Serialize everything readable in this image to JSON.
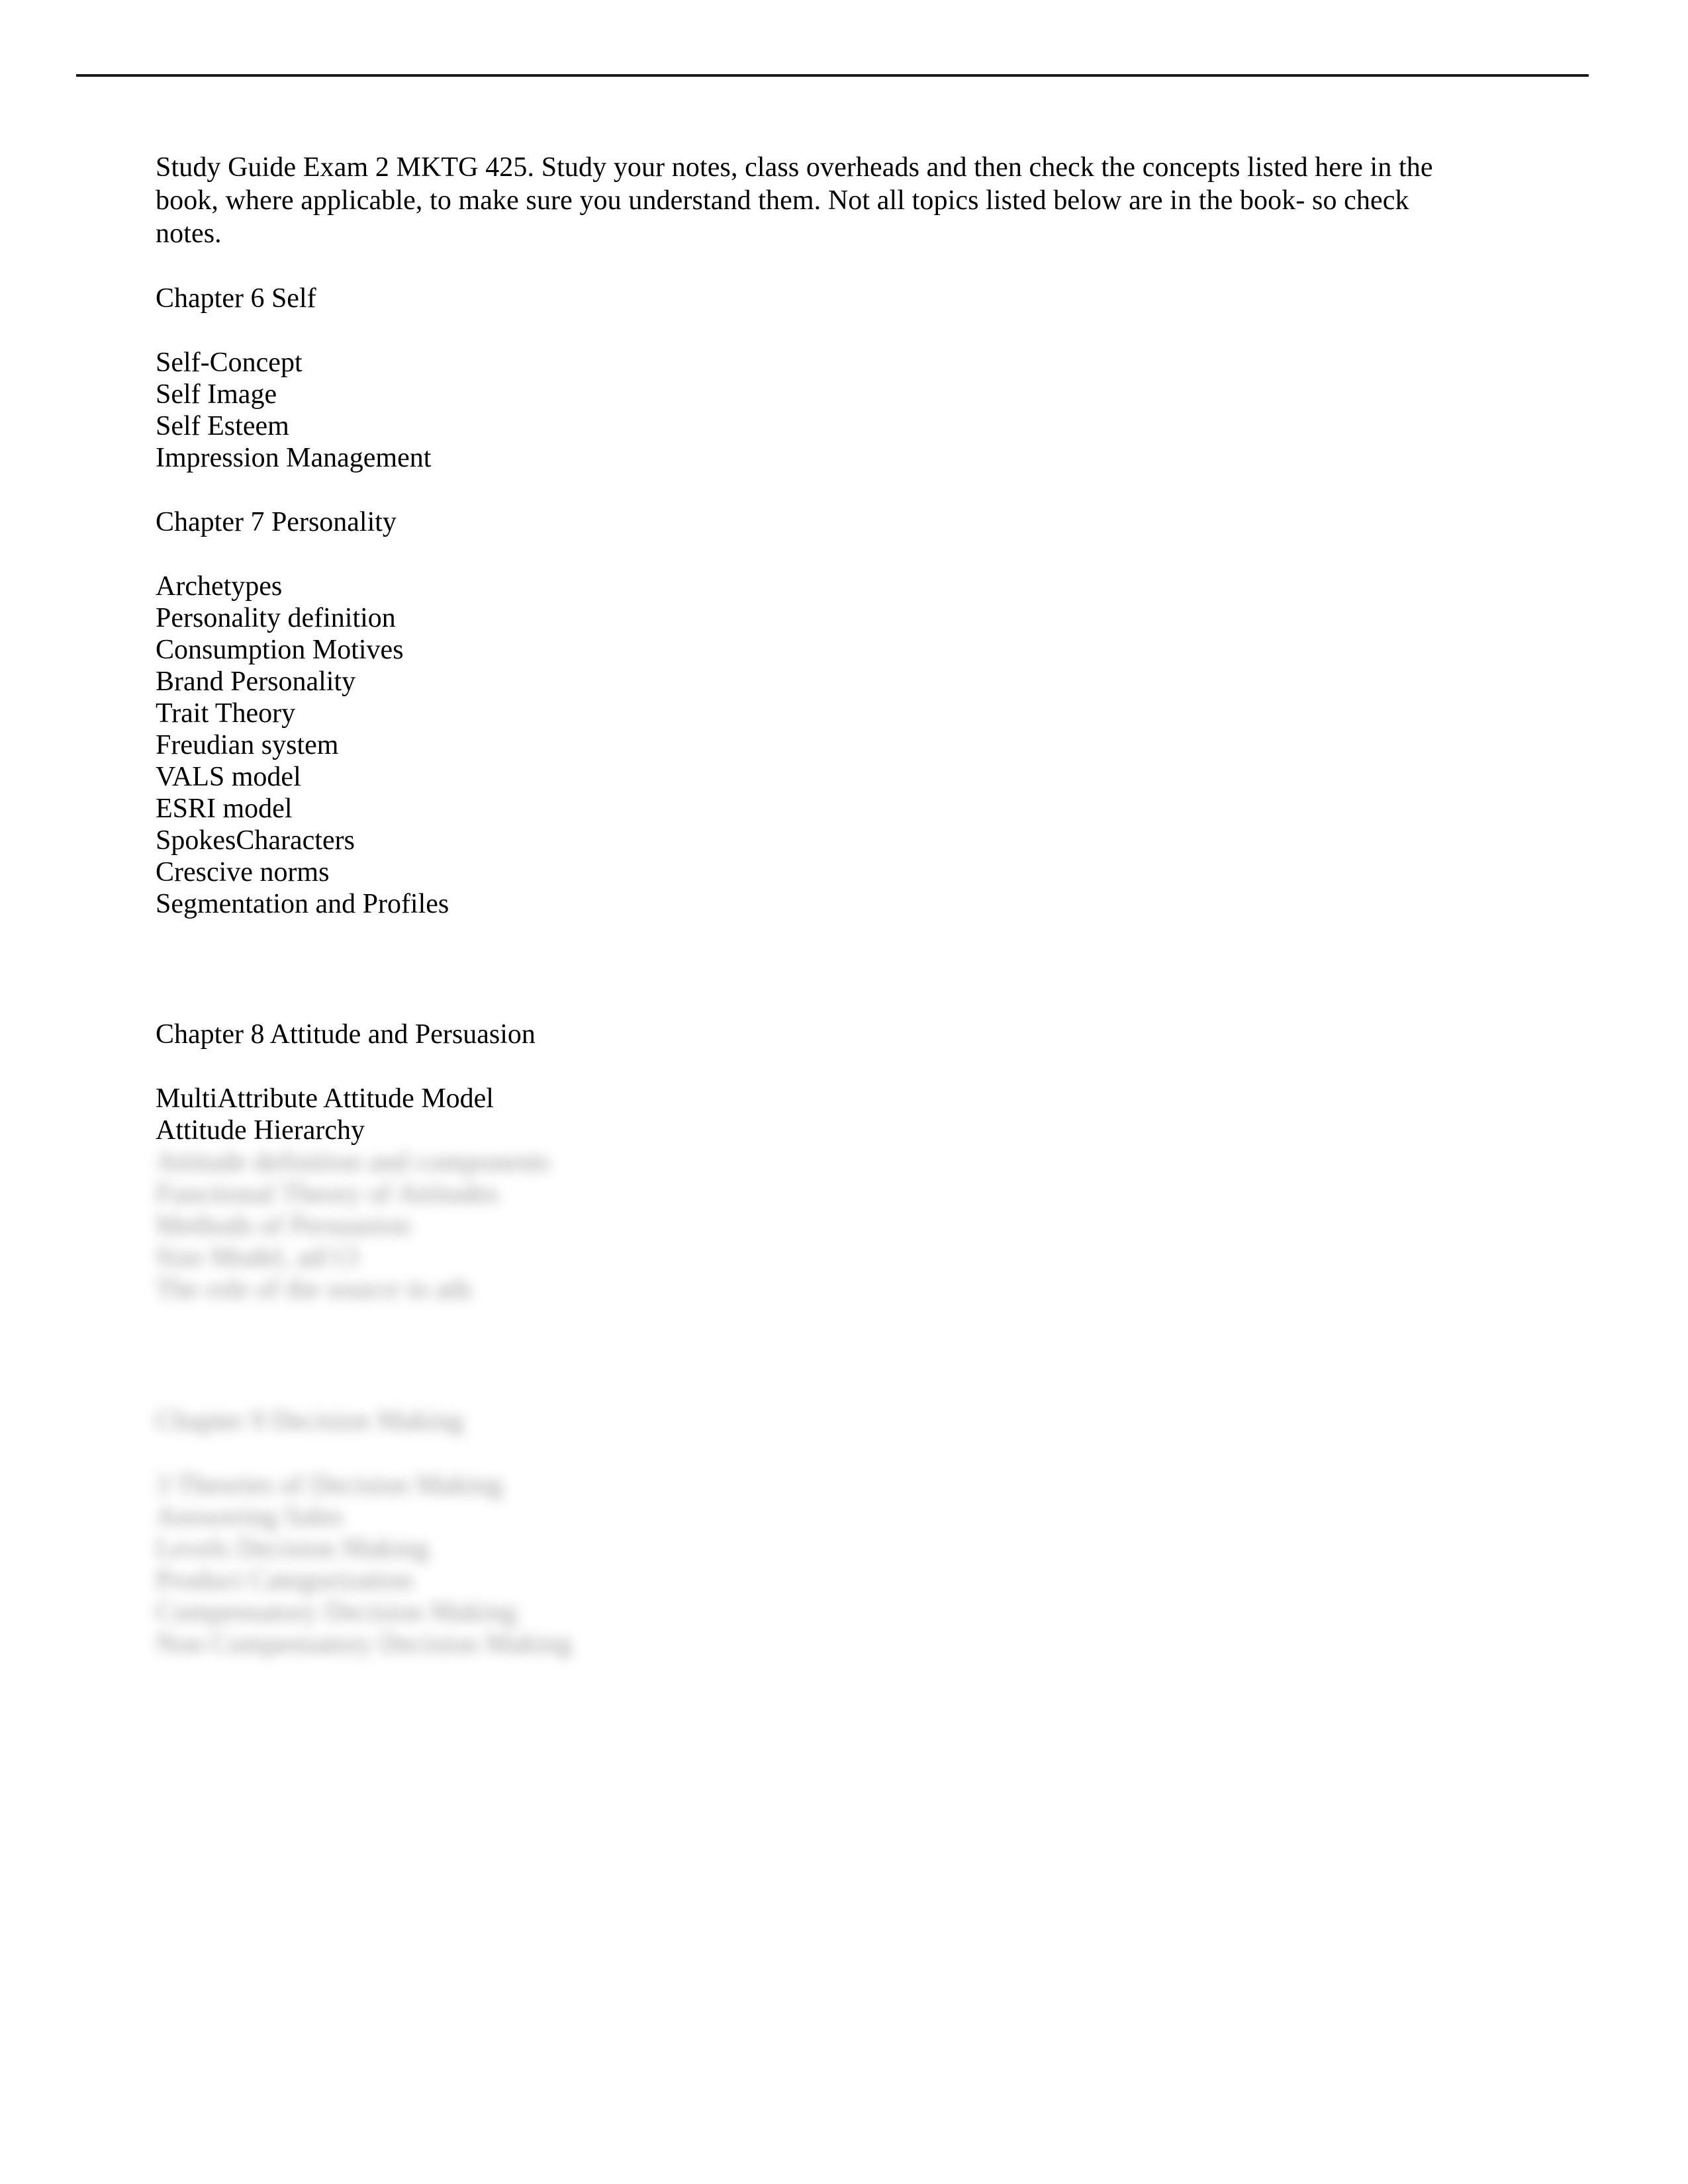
{
  "document": {
    "intro": {
      "line1": "Study Guide Exam 2 MKTG 425. Study your notes, class overheads and then check the concepts listed here in the book,",
      "line2": "where applicable, to make sure you understand them. Not all topics listed below are in the book- so check notes.",
      "full": "Study Guide Exam 2 MKTG 425. Study your notes, class overheads and then check the concepts listed here in the book, where applicable, to make sure you understand them. Not all topics listed below are in the book- so check notes."
    },
    "sections": [
      {
        "heading": "Chapter 6 Self",
        "blurred": false,
        "items": [
          "Self-Concept",
          "Self Image",
          "Self Esteem",
          "Impression Management"
        ]
      },
      {
        "heading": "Chapter 7 Personality",
        "blurred": false,
        "items": [
          "Archetypes",
          "Personality definition",
          "Consumption Motives",
          "Brand Personality",
          "Trait Theory",
          "Freudian system",
          "VALS model",
          "ESRI model",
          "SpokesCharacters",
          "Crescive norms",
          "Segmentation and Profiles"
        ]
      },
      {
        "heading": "Chapter 8 Attitude and Persuasion",
        "blurred": false,
        "items": [
          "MultiAttribute Attitude Model",
          "Attitude Hierarchy"
        ]
      }
    ],
    "blurred_block_1": {
      "heading": "",
      "items": [
        "Attitude definition and components",
        "Functional Theory of Attitudes",
        "Methods of Persuasion",
        "Size Model, ad/13",
        "The role of the source in ads"
      ]
    },
    "blurred_block_2": {
      "heading": "Chapter 9 Decision Making",
      "items": [
        "3 Theories of Decision Making",
        "Answering Sales",
        "Levels Decision Making",
        "Product Categorization",
        "Compensatory Decision Making",
        "Non Compensatory Decision Making"
      ]
    }
  },
  "colors": {
    "page_background": "#ffffff",
    "text": "#000000",
    "rule": "#1a1a1a",
    "blurred_text": "#3a3a3a"
  }
}
